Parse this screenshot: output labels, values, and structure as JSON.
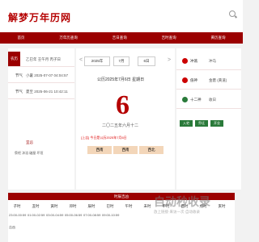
{
  "header": {
    "logo": "解梦万年历网"
  },
  "nav": {
    "items": [
      "首页",
      "万年历查询",
      "吉日查询",
      "吉时查询",
      "黄历查询"
    ]
  },
  "left": {
    "rows": [
      {
        "k": "农历",
        "v": "乙巳年 壬午月 丙子日"
      },
      {
        "k": "节气",
        "v": "小暑 2025-07-07 04:04:57"
      },
      {
        "k": "节气",
        "v": "夏至 2025-06-21 10:42:11"
      }
    ],
    "ji_label": "宜忌",
    "ji_text": "祭祀 沐浴 破屋 坏垣"
  },
  "center": {
    "year": "2025年",
    "month": "7月",
    "day": "6日",
    "solar": "公历2025年7月6日 星期日",
    "day_number": "6",
    "lunar": "二〇二五年六月十二",
    "note": "[上吉] 今日是公历2025年7月6日",
    "tabs": [
      "西南",
      "西南",
      "西北"
    ]
  },
  "right": {
    "rows": [
      {
        "k": "冲煞",
        "v": "冲马"
      },
      {
        "k": "值神",
        "v": "金匮 (黄道)"
      },
      {
        "k": "十二神",
        "v": "收日"
      }
    ],
    "badges": [
      "入宅",
      "乔迁",
      "开业"
    ]
  },
  "table": {
    "title": "时辰吉凶",
    "headers": [
      "子时",
      "丑时",
      "寅时",
      "卯时",
      "辰时",
      "巳时",
      "午时",
      "未时",
      "申时",
      "酉时",
      "戌时",
      "亥时"
    ],
    "row1": [
      "23:00-00:59",
      "01:00-02:59",
      "03:00-04:59",
      "05:00-06:59",
      "07:00-08:59",
      "09:00-10:59",
      "11:00-12:59",
      "13:00-14:59",
      "15:00-16:59",
      "17:00-18:59",
      "19:00-20:59",
      "21:00-22:59"
    ],
    "row_label": "吉凶"
  },
  "watermark": {
    "line1": "自动秒收录",
    "line2": "放上链接·来访一次·自动收录"
  },
  "colors": {
    "brand": "#9b0000",
    "accent": "#b50000",
    "tab": "#f3d6b9"
  }
}
